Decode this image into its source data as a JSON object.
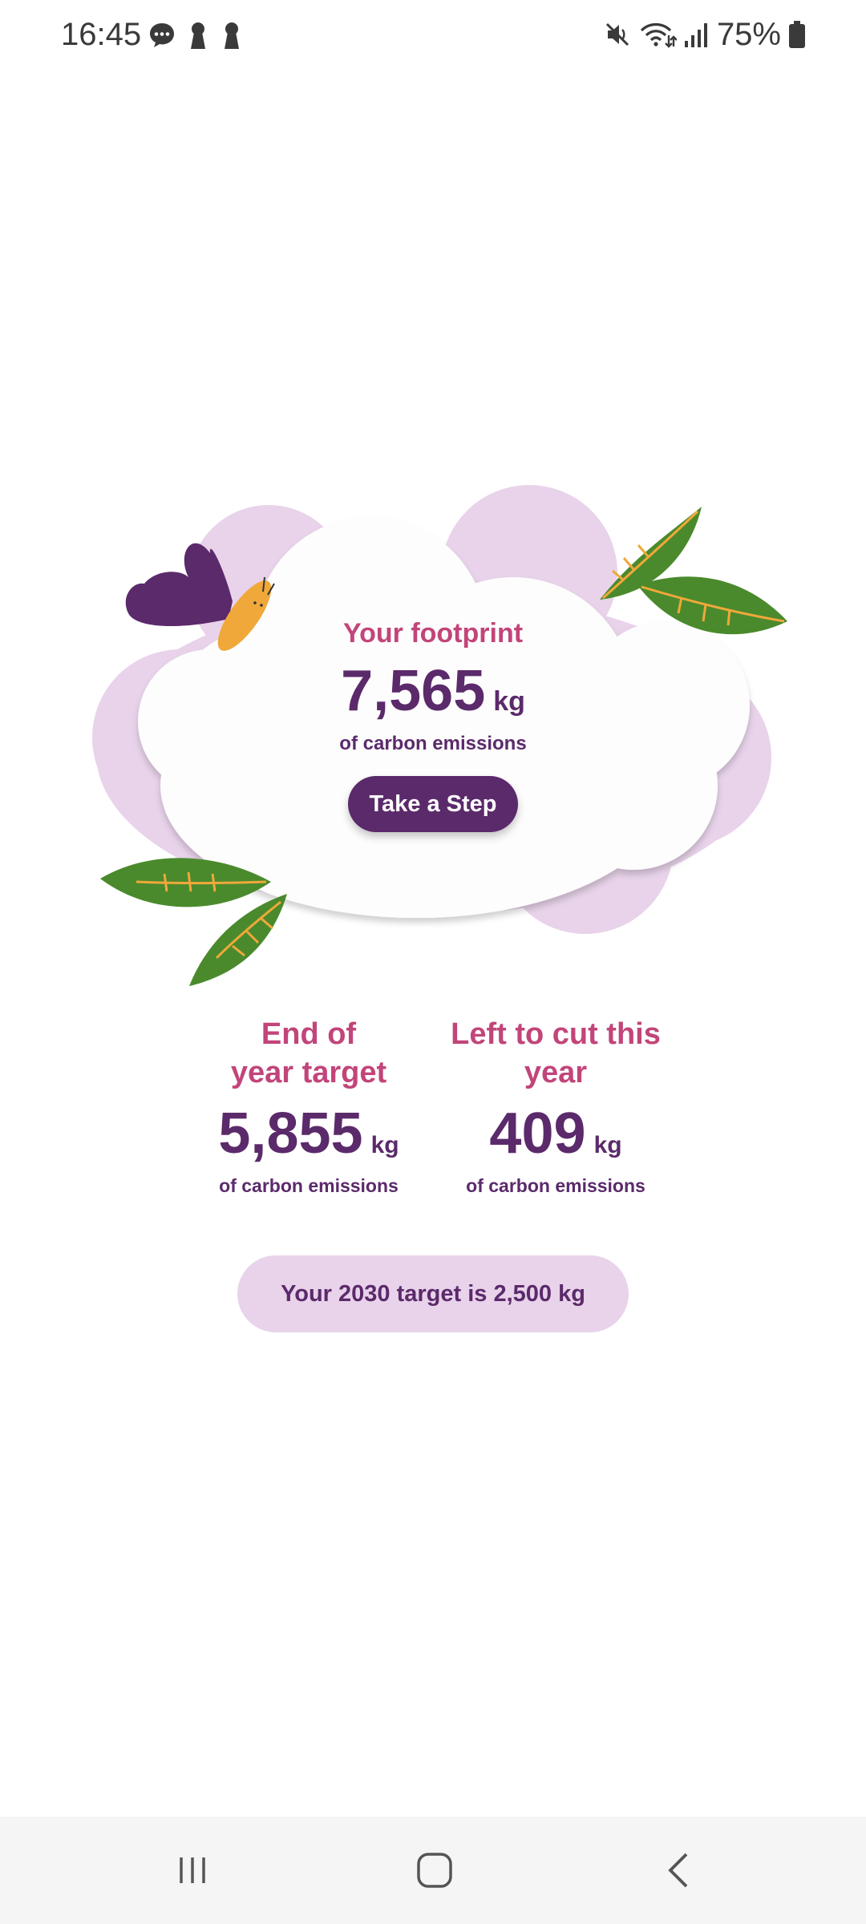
{
  "status_bar": {
    "time": "16:45",
    "left_icons": [
      "chat-bubble-icon",
      "keyhole-icon",
      "keyhole-icon"
    ],
    "right_icons": [
      "mute-icon",
      "wifi-icon",
      "signal-icon",
      "battery-icon"
    ],
    "battery_percent": "75%"
  },
  "hero": {
    "title": "Your footprint",
    "value": "7,565",
    "unit": "kg",
    "subtitle": "of carbon emissions",
    "button_label": "Take a Step"
  },
  "stats": [
    {
      "title_line1": "End of",
      "title_line2": "year target",
      "value": "5,855",
      "unit": "kg",
      "subtitle": "of carbon emissions"
    },
    {
      "title_line1": "Left to cut this",
      "title_line2": "year",
      "value": "409",
      "unit": "kg",
      "subtitle": "of carbon emissions"
    }
  ],
  "target_pill": {
    "label": "Your 2030 target is 2,500 kg"
  },
  "nav_bar": {
    "icons": [
      "recent-apps-icon",
      "home-icon",
      "back-icon"
    ]
  },
  "colors": {
    "primary_purple": "#5b2a6b",
    "accent_pink": "#c2457a",
    "light_lilac": "#e8d3ea",
    "leaf_green": "#4a8a2c",
    "butterfly_orange": "#f0a83a"
  }
}
